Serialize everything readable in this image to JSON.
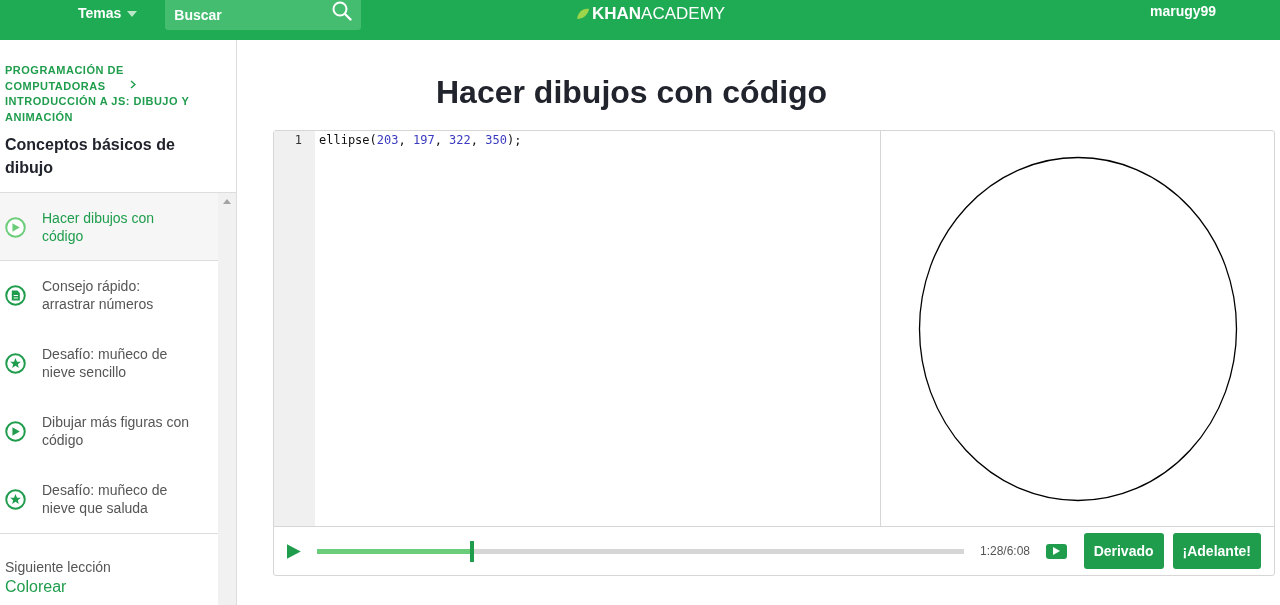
{
  "header": {
    "topics": "Temas",
    "search": {
      "placeholder": "Buscar"
    },
    "logo": {
      "bold": "KHAN",
      "light": "ACADEMY"
    },
    "user": "marugy99"
  },
  "sidebar": {
    "breadcrumbs": [
      "PROGRAMACIÓN DE COMPUTADORAS",
      "INTRODUCCIÓN A JS: DIBUJO Y ANIMACIÓN"
    ],
    "lesson_title": "Conceptos básicos de dibujo",
    "items": [
      {
        "kind": "video",
        "label": "Hacer dibujos con código",
        "selected": true
      },
      {
        "kind": "article",
        "label": "Consejo rápido: arrastrar números",
        "selected": false
      },
      {
        "kind": "challenge",
        "label": "Desafío: muñeco de nieve sencillo",
        "selected": false
      },
      {
        "kind": "video",
        "label": "Dibujar más figuras con código",
        "selected": false
      },
      {
        "kind": "challenge",
        "label": "Desafío: muñeco de nieve que saluda",
        "selected": false
      }
    ],
    "next": {
      "caption": "Siguiente lección",
      "link": "Colorear"
    }
  },
  "page_title": "Hacer dibujos con código",
  "editor": {
    "lines": [
      {
        "number": "1",
        "tokens": [
          {
            "kind": "plain",
            "text": "ellipse("
          },
          {
            "kind": "number",
            "text": "203"
          },
          {
            "kind": "plain",
            "text": ", "
          },
          {
            "kind": "number",
            "text": "197"
          },
          {
            "kind": "plain",
            "text": ", "
          },
          {
            "kind": "number",
            "text": "322"
          },
          {
            "kind": "plain",
            "text": ", "
          },
          {
            "kind": "number",
            "text": "350"
          },
          {
            "kind": "plain",
            "text": ");"
          }
        ]
      }
    ]
  },
  "player": {
    "level": 0.24,
    "time": "1:28/6:08",
    "buttons": [
      "Derivado",
      "¡Adelante!"
    ]
  }
}
